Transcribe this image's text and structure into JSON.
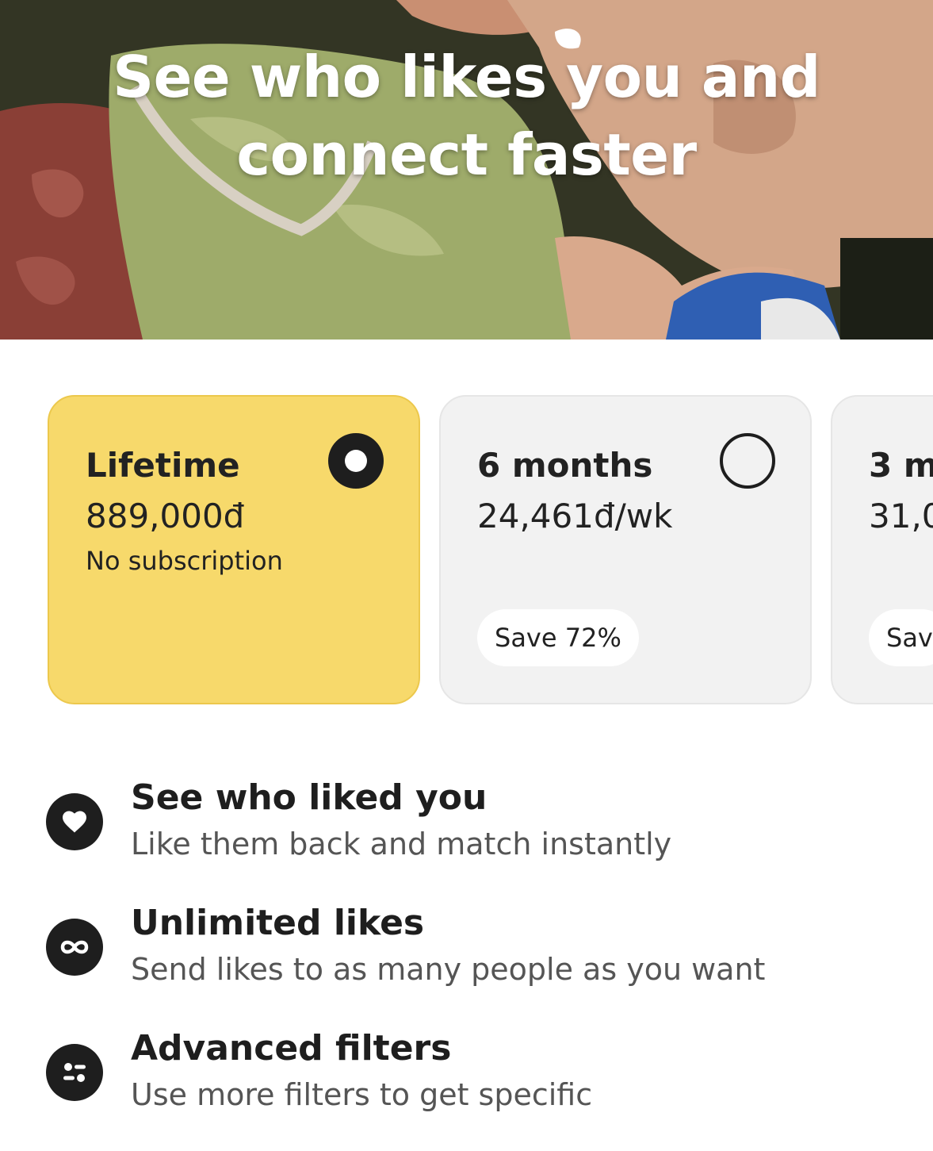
{
  "hero": {
    "title_line1": "See who likes you and",
    "title_line2": "connect faster"
  },
  "plans": [
    {
      "title": "Lifetime",
      "price": "889,000đ",
      "note": "No subscription",
      "selected": true
    },
    {
      "title": "6 months",
      "price": "24,461đ/wk",
      "badge": "Save 72%",
      "selected": false
    },
    {
      "title": "3 m",
      "price": "31,0",
      "badge": "Sav",
      "selected": false
    }
  ],
  "features": [
    {
      "title": "See who liked you",
      "subtitle": "Like them back and match instantly",
      "icon": "heart-icon"
    },
    {
      "title": "Unlimited likes",
      "subtitle": "Send likes to as many people as you want",
      "icon": "infinity-icon"
    },
    {
      "title": "Advanced filters",
      "subtitle": "Use more filters to get specific",
      "icon": "filters-icon"
    }
  ],
  "colors": {
    "selected_plan": "#f7d96b",
    "plan_background": "#f2f2f2",
    "icon_background": "#1e1e1e"
  }
}
